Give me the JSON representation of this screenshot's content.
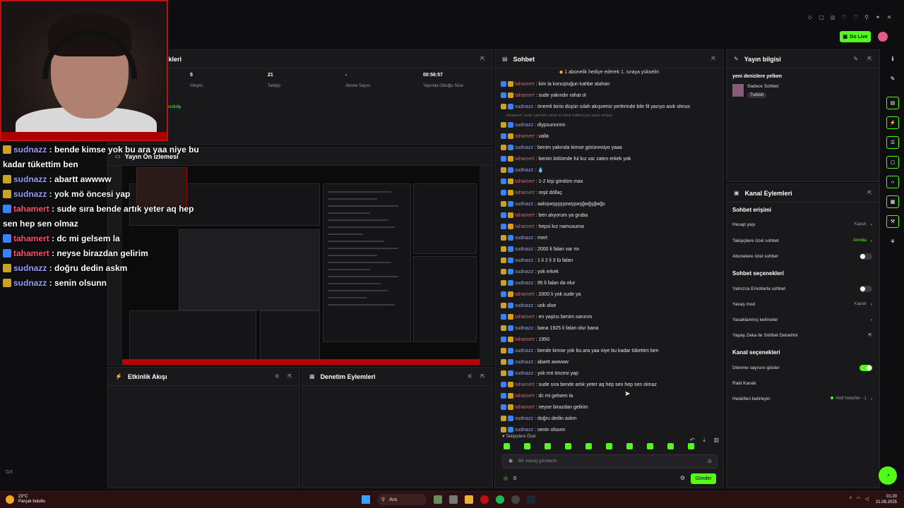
{
  "header": {
    "go_live": "Go Live"
  },
  "stats": {
    "title_fragment": "tikleri",
    "items": [
      {
        "value": "5",
        "label": "İzleyici"
      },
      {
        "value": "21",
        "label": "Takipçi"
      },
      {
        "value": "-",
        "label": "Abone Sayısı"
      },
      {
        "value": "00:56:57",
        "label": "Yayında Olduğu Süre"
      }
    ],
    "success_fragment": "cessfully."
  },
  "preview": {
    "title": "Yayın Ön İzlemesi"
  },
  "activity": {
    "title": "Etkinlik Akışı"
  },
  "moderation": {
    "title": "Denetim Eylemleri"
  },
  "chat": {
    "title": "Sohbet",
    "banner": "1 abonelik hediye ederek 1. sıraya yükselin",
    "messages": [
      {
        "user": "tahamert",
        "text": ": kim la konuştuğun kahbe atahan",
        "kind": "t"
      },
      {
        "user": "tahamert",
        "text": ": sude yakındır rahat ol",
        "kind": "t"
      },
      {
        "user": "sudnazz",
        "text": ": önemli birisi düşün sılah akışverisi yerlerinde bile fil yazıyo asık olmus",
        "kind": "s"
      },
      {
        "reply": "tahamert: sude yakındır rahat ol isimli kullanıcıya yanıt veriyor"
      },
      {
        "user": "sudnazz",
        "text": ": diypsunnnnn",
        "kind": "s"
      },
      {
        "user": "tahamert",
        "text": ": valla",
        "kind": "t"
      },
      {
        "user": "sudnazz",
        "text": ": benim yakında kimse görünmüyo yaaa",
        "kind": "s"
      },
      {
        "user": "tahamert",
        "text": ": benim bölümde ful kız var zaten erkek yok",
        "kind": "t"
      },
      {
        "user": "sudnazz",
        "text": ": 💧",
        "kind": "s"
      },
      {
        "user": "tahamert",
        "text": ": 1-2 kişi gördüm max",
        "kind": "t"
      },
      {
        "user": "tahamert",
        "text": ": reşit döllaç",
        "kind": "t"
      },
      {
        "user": "sudnazz",
        "text": ": aalsşwşşşşşswşşwşğwğşğwğs",
        "kind": "s"
      },
      {
        "user": "tahamert",
        "text": ": ben alıyorum ya gruba",
        "kind": "t"
      },
      {
        "user": "tahamert",
        "text": ": hepsi kız namusuma",
        "kind": "t"
      },
      {
        "user": "sudnazz",
        "text": ": mert",
        "kind": "s"
      },
      {
        "user": "sudnazz",
        "text": ": 2000 li falan var mı",
        "kind": "s"
      },
      {
        "user": "sudnazz",
        "text": ": 1 li 2 li 3 lü falan",
        "kind": "s"
      },
      {
        "user": "sudnazz",
        "text": ": yok erkek",
        "kind": "s"
      },
      {
        "user": "sudnazz",
        "text": ": 95 li falan da olur",
        "kind": "s"
      },
      {
        "user": "tahamert",
        "text": ": 2000 li yok sude ya",
        "kind": "t"
      },
      {
        "user": "sudnazz",
        "text": ": uok olue",
        "kind": "s"
      },
      {
        "user": "tahamert",
        "text": ": en yaşlısı benim sanırım",
        "kind": "t"
      },
      {
        "user": "sudnazz",
        "text": ": bana 1925 li falan olur bana",
        "kind": "s"
      },
      {
        "user": "tahamert",
        "text": ": 1950",
        "kind": "t"
      },
      {
        "user": "sudnazz",
        "text": ": bende kimse yok bu ara yaa niye bu kadar tükettim ben",
        "kind": "s"
      },
      {
        "user": "sudnazz",
        "text": ": abartt awwww",
        "kind": "s"
      },
      {
        "user": "sudnazz",
        "text": ": yok mö öncesi yap",
        "kind": "s"
      },
      {
        "user": "tahamert",
        "text": ": sude sıra bende artık yeter aq hep sen hep sen olmaz",
        "kind": "t"
      },
      {
        "user": "tahamert",
        "text": ": dc mi gelsem la",
        "kind": "t"
      },
      {
        "user": "tahamert",
        "text": ": neyse birazdan gelirim",
        "kind": "t"
      },
      {
        "user": "sudnazz",
        "text": ": doğru dedin askm",
        "kind": "s"
      },
      {
        "user": "sudnazz",
        "text": ": senin olsunn",
        "kind": "s"
      }
    ],
    "followers_only": "Takipçilere Özel",
    "input_placeholder": "Bir mesaj gönderin",
    "points": "0",
    "send_label": "Gönder"
  },
  "stream_info": {
    "title": "Yayın bilgisi",
    "stream_title": "yeni denizlere yelken",
    "category": "Sadece Sohbet",
    "tag": "Turkish"
  },
  "channel_actions": {
    "title": "Kanal Eylemleri",
    "chat_access": "Sohbet erişimi",
    "account_age": "Hesap yaşı",
    "account_age_val": "Kapalı",
    "followers_chat": "Takipçilere özel sohbet",
    "followers_chat_val": "Anında",
    "subs_chat": "Abonelere özel sohbet",
    "chat_options": "Sohbet seçenekleri",
    "emotes_only": "Yalnızca Emotlarla sohbet",
    "slow_mode": "Yavaş mod",
    "slow_mode_val": "Kapalı",
    "banned_words": "Yasaklanmış kelimeler",
    "ai_moderation": "Yapay Zeka ile Sohbet Denetimi",
    "channel_options": "Kanal seçenekleri",
    "show_viewers": "İzlenme sayısını göster",
    "raid": "Raid Kanalı",
    "targets": "Hedefleri belirleyin",
    "targets_val": "Aktif hedefler - 1"
  },
  "overlay_chat": [
    {
      "user": "sudnazz",
      "text": " : bende kimse yok bu ara yaa niye bu kadar tükettim ben",
      "kind": "s"
    },
    {
      "user": "sudnazz",
      "text": " : abartt awwww",
      "kind": "s"
    },
    {
      "user": "sudnazz",
      "text": " : yok mö öncesi yap",
      "kind": "s"
    },
    {
      "user": "tahamert",
      "text": " : sude sıra bende artık yeter aq hep sen hep sen olmaz",
      "kind": "t"
    },
    {
      "user": "tahamert",
      "text": " : dc mi gelsem la",
      "kind": "t"
    },
    {
      "user": "tahamert",
      "text": " : neyse birazdan gelirim",
      "kind": "t"
    },
    {
      "user": "sudnazz",
      "text": " : doğru dedin askm",
      "kind": "s"
    },
    {
      "user": "sudnazz",
      "text": " : senin olsunn",
      "kind": "s"
    }
  ],
  "overlay_misc": {
    "gx": "GX"
  },
  "taskbar": {
    "temp": "23°C",
    "weather": "Parçalı bulutlu",
    "search": "Ara",
    "time": "01:20",
    "date": "21.08.2025"
  },
  "colors": {
    "accent": "#53fc18",
    "user_t": "#ff4d6a",
    "user_s": "#9b9bff"
  }
}
